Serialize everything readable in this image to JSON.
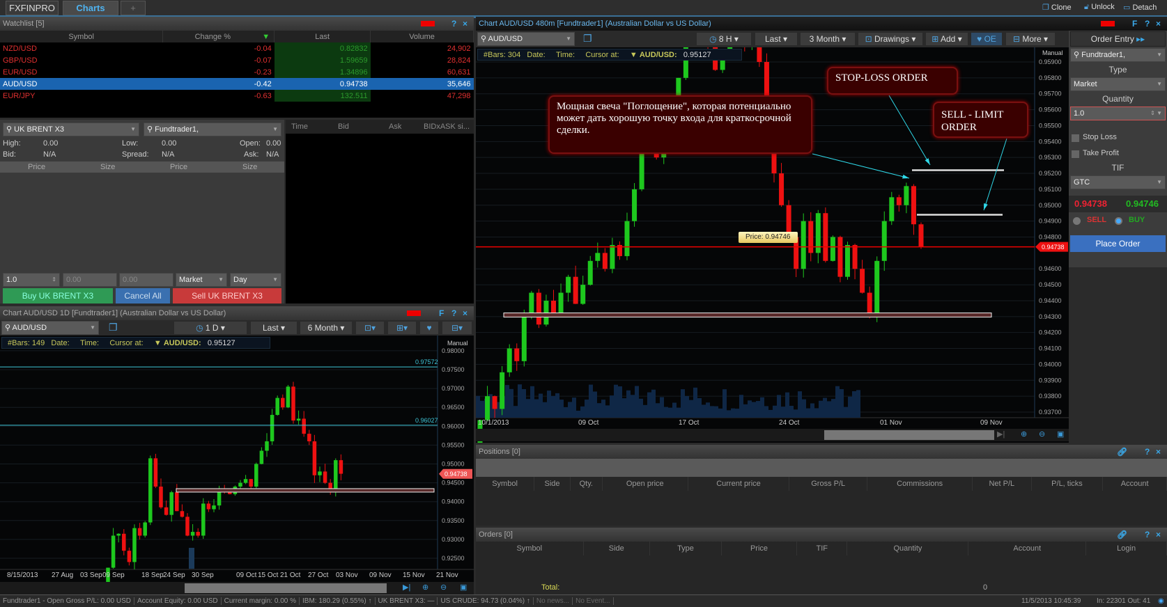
{
  "tabs": [
    "FXFINPRO",
    "Charts",
    "+"
  ],
  "top_actions": {
    "clone": "Clone",
    "unlock": "Unlock",
    "detach": "Detach"
  },
  "watchlist": {
    "title": "Watchlist [5]",
    "columns": [
      "Symbol",
      "Change %",
      "Last",
      "Volume"
    ],
    "rows": [
      {
        "symbol": "NZD/USD",
        "change": "-0.04",
        "last": "0.82832",
        "volume": "24,902"
      },
      {
        "symbol": "GBP/USD",
        "change": "-0.07",
        "last": "1.59659",
        "volume": "28,824"
      },
      {
        "symbol": "EUR/USD",
        "change": "-0.23",
        "last": "1.34896",
        "volume": "60,631"
      },
      {
        "symbol": "AUD/USD",
        "change": "-0.42",
        "last": "0.94738",
        "volume": "35,646"
      },
      {
        "symbol": "EUR/JPY",
        "change": "-0.63",
        "last": "132.511",
        "volume": "47,298"
      }
    ]
  },
  "order_panel": {
    "symbol": "UK BRENT X3",
    "account": "Fundtrader1,",
    "high_label": "High:",
    "high": "0.00",
    "low_label": "Low:",
    "low": "0.00",
    "open_label": "Open:",
    "open": "0.00",
    "bid_label": "Bid:",
    "bid": "N/A",
    "spread_label": "Spread:",
    "spread": "N/A",
    "ask_label": "Ask:",
    "ask": "N/A",
    "depth_cols": [
      "Price",
      "Size",
      "Price",
      "Size"
    ],
    "quantity": "1.0",
    "price1": "0.00",
    "price2": "0.00",
    "type": "Market",
    "tif": "Day",
    "buy": "Buy UK BRENT X3",
    "cancel": "Cancel All",
    "sell": "Sell UK BRENT X3",
    "tape_cols": [
      "Time",
      "Bid",
      "Ask",
      "BIDxASK si..."
    ]
  },
  "small_chart": {
    "title": "Chart AUD/USD 1D [Fundtrader1] (Australian Dollar vs US Dollar)",
    "symbol": "AUD/USD",
    "interval": "1 D",
    "price_type": "Last",
    "range": "6 Month",
    "bars": "#Bars: 149",
    "date": "Date:",
    "time": "Time:",
    "cursor": "Cursor at:",
    "pair": "AUD/USD:",
    "value": "0.95127",
    "manual": "Manual",
    "level1": "0.97572",
    "level2": "0.96027",
    "current": "0.94738",
    "yticks": [
      "0.98000",
      "0.97500",
      "0.97000",
      "0.96500",
      "0.96000",
      "0.95500",
      "0.95000",
      "0.94500",
      "0.94000",
      "0.93500",
      "0.93000",
      "0.92500"
    ],
    "xticks": [
      "8/15/2013",
      "27 Aug",
      "03 Sep",
      "09 Sep",
      "18 Sep",
      "24 Sep",
      "30 Sep",
      "09 Oct",
      "15 Oct",
      "21 Oct",
      "27 Oct",
      "03 Nov",
      "09 Nov",
      "15 Nov",
      "21 Nov"
    ]
  },
  "main_chart": {
    "title": "Chart AUD/USD 480m [Fundtrader1] (Australian Dollar vs US Dollar)",
    "symbol": "AUD/USD",
    "interval": "8 H",
    "price_type": "Last",
    "range": "3 Month",
    "drawings": "Drawings",
    "add": "Add",
    "oe": "OE",
    "more": "More",
    "bars": "#Bars: 304",
    "date": "Date:",
    "time": "Time:",
    "cursor": "Cursor at:",
    "pair": "AUD/USD:",
    "value": "0.95127",
    "manual": "Manual",
    "current": "0.94738",
    "price_tip": "Price: 0.94746",
    "yticks": [
      "0.95900",
      "0.95800",
      "0.95700",
      "0.95600",
      "0.95500",
      "0.95400",
      "0.95300",
      "0.95200",
      "0.95100",
      "0.95000",
      "0.94900",
      "0.94800",
      "0.94600",
      "0.94500",
      "0.94400",
      "0.94300",
      "0.94200",
      "0.94100",
      "0.94000",
      "0.93900",
      "0.93800",
      "0.93700"
    ],
    "xticks": [
      "10/1/2013",
      "09 Oct",
      "17 Oct",
      "24 Oct",
      "01 Nov",
      "09 Nov"
    ],
    "callout_main": "Мощная свеча \"Поглощение\", которая потенциально может дать хорошую точку входа для краткосрочной сделки.",
    "callout_stop": "STOP-LOSS ORDER",
    "callout_limit": "SELL - LIMIT ORDER"
  },
  "order_entry": {
    "title": "Order Entry",
    "account": "Fundtrader1,",
    "type_label": "Type",
    "type": "Market",
    "qty_label": "Quantity",
    "qty": "1.0",
    "stop_loss": "Stop Loss",
    "take_profit": "Take Profit",
    "tif_label": "TIF",
    "tif": "GTC",
    "sell_price": "0.94738",
    "buy_price": "0.94746",
    "sell": "SELL",
    "buy": "BUY",
    "place": "Place Order"
  },
  "positions": {
    "title": "Positions [0]",
    "columns": [
      "Symbol",
      "Side",
      "Qty.",
      "Open price",
      "Current price",
      "Gross P/L",
      "Commissions",
      "Net P/L",
      "P/L, ticks",
      "Account"
    ]
  },
  "orders": {
    "title": "Orders [0]",
    "columns": [
      "Symbol",
      "Side",
      "Type",
      "Price",
      "TIF",
      "Quantity",
      "Account",
      "Login"
    ],
    "total_label": "Total:",
    "total": "0"
  },
  "status": {
    "account": "Fundtrader1 - Open Gross  P/L: 0.00 USD",
    "equity": "Account Equity: 0.00 USD",
    "margin": "Current margin: 0.00 %",
    "ibm": "IBM: 180.29 (0.55%) ↑",
    "brent": "UK BRENT X3: —",
    "crude": "US CRUDE: 94.73 (0.04%) ↑",
    "news": "No news...",
    "event": "No Event...",
    "datetime": "11/5/2013 10:45:39",
    "io": "In: 22301 Out: 41"
  },
  "chart_data": [
    {
      "type": "candlestick",
      "name": "AUD/USD 8H",
      "ylim": [
        0.9362,
        0.9605
      ],
      "closes": [
        0.9365,
        0.938,
        0.9372,
        0.9395,
        0.941,
        0.9402,
        0.943,
        0.9445,
        0.9425,
        0.944,
        0.9432,
        0.9445,
        0.9455,
        0.9438,
        0.945,
        0.9465,
        0.947,
        0.946,
        0.9475,
        0.9468,
        0.949,
        0.951,
        0.9545,
        0.956,
        0.953,
        0.9545,
        0.9555,
        0.958,
        0.962,
        0.9605,
        0.9615,
        0.96,
        0.9585,
        0.9595,
        0.961,
        0.9625,
        0.96,
        0.9612,
        0.959,
        0.956,
        0.952,
        0.95,
        0.948,
        0.946,
        0.949,
        0.947,
        0.9495,
        0.9465,
        0.948,
        0.9455,
        0.9475,
        0.946,
        0.9445,
        0.943,
        0.9465,
        0.949,
        0.9505,
        0.95,
        0.9512,
        0.9488,
        0.9474
      ],
      "levels": {
        "current": 0.94738,
        "support": 0.9431,
        "stop_loss": 0.9522,
        "sell_limit": 0.9494
      }
    },
    {
      "type": "candlestick",
      "name": "AUD/USD 1D",
      "ylim": [
        0.922,
        0.981
      ],
      "closes": [
        0.9225,
        0.931,
        0.9315,
        0.927,
        0.924,
        0.933,
        0.931,
        0.9345,
        0.9515,
        0.944,
        0.9385,
        0.9365,
        0.9425,
        0.9375,
        0.936,
        0.931,
        0.932,
        0.931,
        0.9395,
        0.938,
        0.939,
        0.943,
        0.9425,
        0.942,
        0.944,
        0.945,
        0.946,
        0.944,
        0.95,
        0.9535,
        0.956,
        0.963,
        0.9675,
        0.965,
        0.9705,
        0.9615,
        0.962,
        0.958,
        0.956,
        0.947,
        0.948,
        0.945,
        0.943,
        0.951,
        0.9474
      ],
      "levels": {
        "resistance1": 0.97572,
        "resistance2": 0.96027,
        "support": 0.943,
        "current": 0.94738
      }
    }
  ]
}
